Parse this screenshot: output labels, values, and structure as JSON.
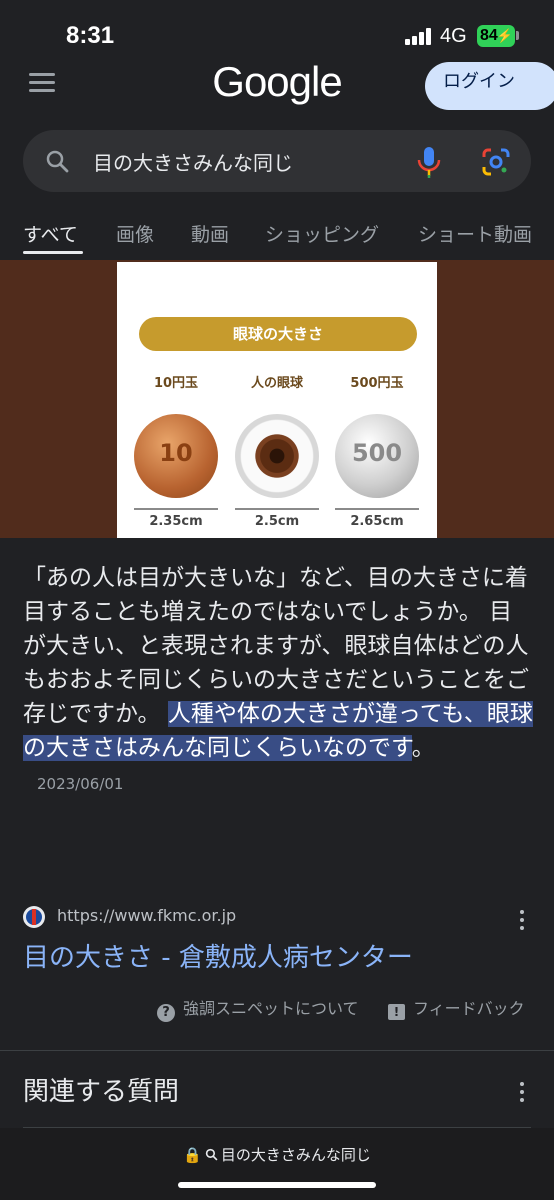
{
  "status": {
    "time": "8:31",
    "network": "4G",
    "battery": "84"
  },
  "header": {
    "logo": "Google",
    "login_label": "ログイン"
  },
  "search": {
    "query": "目の大きさみんな同じ"
  },
  "tabs": [
    {
      "label": "すべて",
      "active": true
    },
    {
      "label": "画像",
      "active": false
    },
    {
      "label": "動画",
      "active": false
    },
    {
      "label": "ショッピング",
      "active": false
    },
    {
      "label": "ショート動画",
      "active": false
    }
  ],
  "image": {
    "title": "眼球の大きさ",
    "items": [
      {
        "label": "10円玉",
        "coin_text": "10",
        "size": "2.35cm"
      },
      {
        "label": "人の眼球",
        "coin_text": "",
        "size": "2.5cm"
      },
      {
        "label": "500円玉",
        "coin_text": "500",
        "size": "2.65cm"
      }
    ]
  },
  "snippet": {
    "text": "「あの人は目が大きいな」など、目の大きさに着目することも増えたのではないでしょうか。 目が大きい、と表現されますが、眼球自体はどの人もおおよそ同じくらいの大きさだということをご存じですか。 ",
    "highlight": "人種や体の大きさが違っても、眼球の大きさはみんな同じくらいなのです",
    "tail": "。",
    "date": "2023/06/01"
  },
  "source": {
    "url": "https://www.fkmc.or.jp",
    "title": "目の大きさ - 倉敷成人病センター"
  },
  "snippet_footer": {
    "about_label": "強調スニペットについて",
    "feedback_label": "フィードバック"
  },
  "related": {
    "title": "関連する質問"
  },
  "bottom_bar": {
    "url_text": "目の大きさみんな同じ"
  }
}
